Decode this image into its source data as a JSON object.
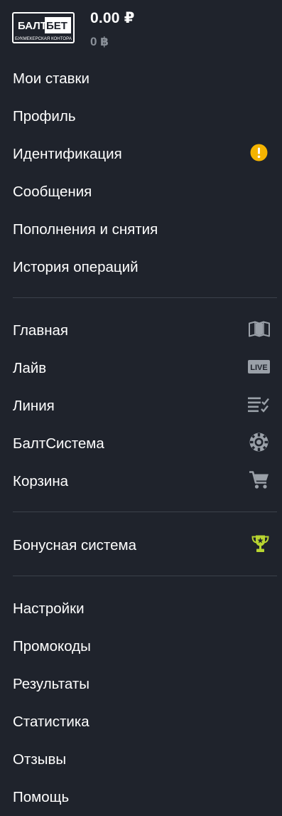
{
  "header": {
    "logo_text_top_left": "БАЛТ",
    "logo_text_top_right": "БЕТ",
    "logo_text_bottom": "БУКМЕКЕРСКАЯ КОНТОРА",
    "balance": "0.00 ₽",
    "bonus_balance": "0 ฿"
  },
  "account_menu": [
    {
      "label": "Мои ставки"
    },
    {
      "label": "Профиль"
    },
    {
      "label": "Идентификация",
      "icon": "alert-circle-icon",
      "icon_color": "#f5b400"
    },
    {
      "label": "Сообщения"
    },
    {
      "label": "Пополнения и снятия"
    },
    {
      "label": "История операций"
    }
  ],
  "main_menu": [
    {
      "label": "Главная",
      "icon": "map-icon"
    },
    {
      "label": "Лайв",
      "icon": "live-icon",
      "icon_text": "LIVE"
    },
    {
      "label": "Линия",
      "icon": "list-check-icon"
    },
    {
      "label": "БалтСистема",
      "icon": "poker-chip-icon"
    },
    {
      "label": "Корзина",
      "icon": "cart-icon"
    }
  ],
  "bonus_menu": [
    {
      "label": "Бонусная система",
      "icon": "trophy-icon",
      "icon_color": "#b8d430"
    }
  ],
  "info_menu": [
    {
      "label": "Настройки"
    },
    {
      "label": "Промокоды"
    },
    {
      "label": "Результаты"
    },
    {
      "label": "Статистика"
    },
    {
      "label": "Отзывы"
    },
    {
      "label": "Помощь"
    }
  ],
  "colors": {
    "background": "#1f232c",
    "text": "#ffffff",
    "muted": "#8a9099",
    "divider": "#3b414b",
    "icon_gray": "#9aa0a8",
    "warning": "#f5b400",
    "trophy": "#b8d430"
  }
}
